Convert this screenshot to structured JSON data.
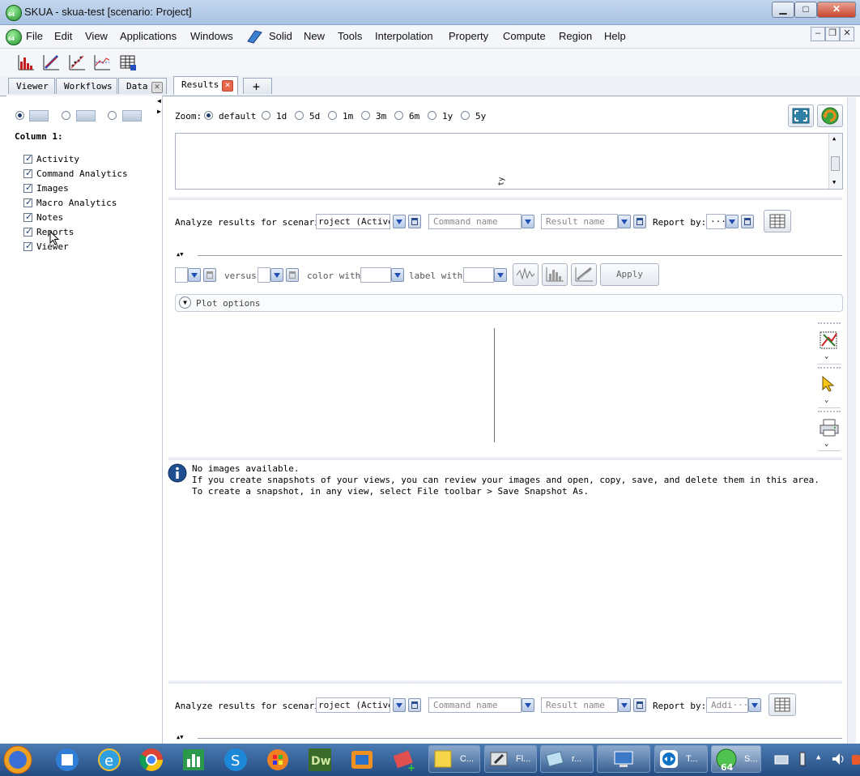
{
  "window": {
    "title": "SKUA - skua-test  [scenario: Project]",
    "controls": {
      "minimize": "▁",
      "maximize": "□",
      "close": "✕"
    }
  },
  "menubar": {
    "items": [
      "File",
      "Edit",
      "View",
      "Applications",
      "Windows",
      "Solid",
      "New",
      "Tools",
      "Interpolation",
      "Property",
      "Compute",
      "Region",
      "Help"
    ],
    "mdi_controls": {
      "minimize": "–",
      "restore": "❐",
      "close": "✕"
    }
  },
  "toolbar": {
    "icons": [
      "bar-chart-icon",
      "crossplot-icon",
      "scatter-icon",
      "line-plot-icon",
      "table-grid-icon"
    ]
  },
  "tabs": [
    {
      "label": "Viewer",
      "closable": false,
      "active": false
    },
    {
      "label": "Workflows",
      "closable": false,
      "active": false
    },
    {
      "label": "Data",
      "closable": true,
      "active": false
    },
    {
      "label": "Results",
      "closable": true,
      "active": true
    }
  ],
  "tab_add_label": "+",
  "left_panel": {
    "column_title": "Column 1:",
    "layout_options_selected": 0,
    "items": [
      {
        "label": "Activity",
        "checked": true
      },
      {
        "label": "Command Analytics",
        "checked": true
      },
      {
        "label": "Images",
        "checked": true
      },
      {
        "label": "Macro Analytics",
        "checked": true
      },
      {
        "label": "Notes",
        "checked": true
      },
      {
        "label": "Reports",
        "checked": true
      },
      {
        "label": "Viewer",
        "checked": true
      }
    ]
  },
  "activity": {
    "zoom_label": "Zoom:",
    "zoom_options": [
      "default",
      "1d",
      "5d",
      "1m",
      "3m",
      "6m",
      "1y",
      "5y"
    ],
    "zoom_selected": "default",
    "chart_axis_fragment": "ty"
  },
  "command_analytics": {
    "analyze_label": "Analyze results for scenario",
    "scenario_value": "roject (Active)",
    "command_placeholder": "Command name",
    "result_placeholder": "Result name",
    "report_by_label": "Report by:",
    "report_by_value": "···",
    "versus_label": "versus",
    "color_with_label": "color with",
    "label_with_label": "label with",
    "apply_label": "Apply",
    "plot_options_label": "Plot options"
  },
  "images": {
    "line1": "No images available.",
    "line2": "If you create snapshots of your views, you can review your images and open, copy, save, and delete them in this area.",
    "line3": "To create a snapshot, in any view, select File toolbar > Save Snapshot As."
  },
  "macro_analytics": {
    "analyze_label": "Analyze results for scenario",
    "scenario_value": "roject (Active)",
    "command_placeholder": "Command name",
    "result_placeholder": "Result name",
    "report_by_label": "Report by:",
    "report_by_value": "Addi···"
  },
  "taskbar": {
    "tasks": [
      {
        "label": "C...",
        "icon": "sticky-note-icon"
      },
      {
        "label": "Fl...",
        "icon": "flash-tool-icon"
      },
      {
        "label": "r...",
        "icon": "notepad-icon"
      },
      {
        "label": "",
        "icon": "remote-desktop-icon"
      },
      {
        "label": "T...",
        "icon": "teamviewer-icon"
      },
      {
        "label": "S...",
        "icon": "skua-icon"
      }
    ]
  }
}
